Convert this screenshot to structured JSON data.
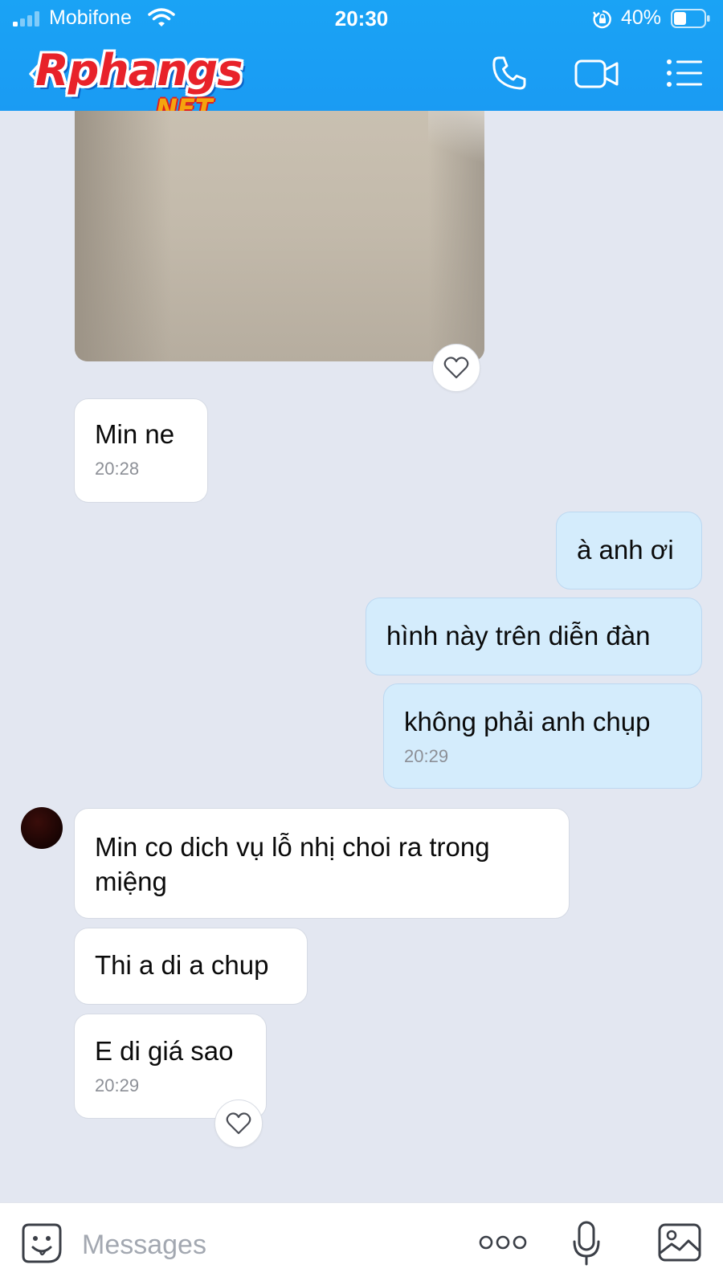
{
  "status_bar": {
    "carrier": "Mobifone",
    "time": "20:30",
    "battery": "40%"
  },
  "header": {
    "watermark_main": "Rphangs",
    "watermark_sub": ".NET",
    "icons": [
      "back-icon",
      "phone-icon",
      "video-camera-icon",
      "menu-list-icon"
    ]
  },
  "messages": [
    {
      "type": "photo",
      "direction": "incoming",
      "liked_reaction": "heart-icon"
    },
    {
      "direction": "incoming",
      "text": "Min ne",
      "time": "20:28"
    },
    {
      "direction": "outgoing",
      "text": "à anh ơi"
    },
    {
      "direction": "outgoing",
      "text": "hình này trên diễn đàn"
    },
    {
      "direction": "outgoing",
      "text": "không phải anh chụp",
      "time": "20:29"
    },
    {
      "direction": "incoming",
      "text_line1": "Min co dich vụ lỗ nhị choi ra trong",
      "text_line2": "miệng"
    },
    {
      "direction": "incoming",
      "text": "Thi a di a chup"
    },
    {
      "direction": "incoming",
      "text": "E di giá sao",
      "time": "20:29",
      "liked_reaction": "heart-icon"
    }
  ],
  "composer": {
    "placeholder": "Messages",
    "icons": [
      "sticker-icon",
      "more-options-icon",
      "microphone-icon",
      "image-icon"
    ]
  },
  "colors": {
    "header_blue": "#1aa3f5",
    "chat_background": "#e3e7f1",
    "outgoing_bubble": "#d4ecfc",
    "incoming_bubble": "#ffffff"
  }
}
